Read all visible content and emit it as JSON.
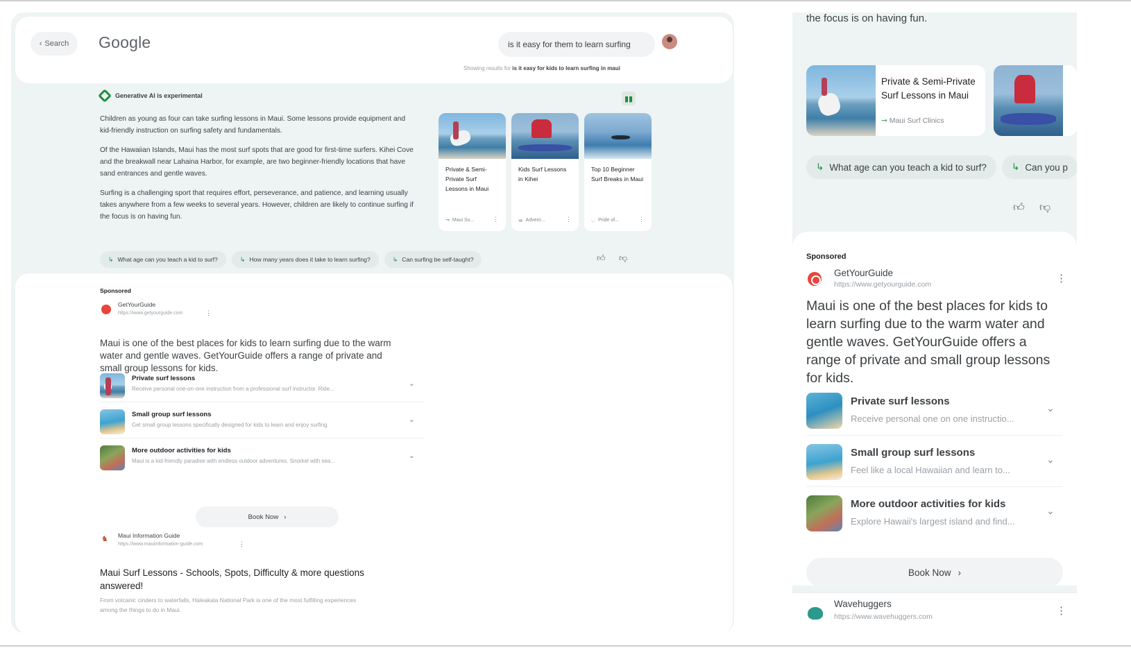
{
  "desktop": {
    "back_label": "Search",
    "logo": "Google",
    "query": "is it easy for them to learn surfing",
    "showing_prefix": "Showing results for",
    "showing_query": "is it easy for kids to learn surfing in maui",
    "ai_label": "Generative AI is experimental",
    "ai_paragraphs": [
      "Children as young as four can take surfing lessons in Maui. Some lessons provide equipment and kid-friendly instruction on surfing safety and fundamentals.",
      "Of the Hawaiian Islands, Maui has the most surf spots that are good for first-time surfers. Kihei Cove and the breakwall near Lahaina Harbor, for example, are two beginner-friendly locations that have sand entrances and gentle waves.",
      "Surfing is a challenging sport that requires effort, perseverance, and patience, and learning usually takes anywhere from a few weeks to several years. However, children are likely to continue surfing if the focus is on having fun."
    ],
    "cards": [
      {
        "title": "Private & Semi-Private Surf Lessons in Maui",
        "source": "Maui Su..."
      },
      {
        "title": "Kids Surf Lessons in Kihei",
        "source": "Advent..."
      },
      {
        "title": "Top 10 Beginner Surf Breaks in Maui",
        "source": "Pride of..."
      }
    ],
    "chips": [
      "What age can you teach a kid to surf?",
      "How many years does it take to learn surfing?",
      "Can surfing be self-taught?"
    ],
    "sponsored": "Sponsored",
    "ad": {
      "site": "GetYourGuide",
      "url": "https://www.getyourguide.com",
      "description": "Maui is one of the best places for kids to learn surfing due to the warm water and gentle waves. GetYourGuide offers a range of private and small group lessons for kids.",
      "offers": [
        {
          "title": "Private surf lessons",
          "desc": "Receive personal one-on-one instruction from a professional surf instructor. Ride..."
        },
        {
          "title": "Small group surf lessons",
          "desc": "Get small group lessons specifically designed for kids to learn and enjoy surfing."
        },
        {
          "title": "More outdoor activities for kids",
          "desc": "Maui is a kid-friendly paradise with endless outdoor adventures. Snorkel with sea..."
        }
      ],
      "book_label": "Book Now"
    },
    "result": {
      "site": "Maui Information Guide",
      "url": "https://www.mauiinformation-guide.com",
      "title": "Maui Surf Lessons - Schools, Spots, Difficulty & more questions answered!",
      "snippet": "From volcanic cinders to waterfalls, Haleakala National Park is one of the most fulfilling experiences among the things to do in Maui."
    }
  },
  "mobile": {
    "fragment": "the focus is on having fun.",
    "card": {
      "title": "Private & Semi-Private Surf Lessons in Maui",
      "source": "Maui Surf Clinics"
    },
    "chip1": "What age can you teach a kid to surf?",
    "chip2": "Can you p",
    "sponsored": "Sponsored",
    "ad": {
      "site": "GetYourGuide",
      "url": "https://www.getyourguide.com",
      "description": "Maui is one of the best places for kids to learn surfing due to the warm water and gentle waves. GetYourGuide offers a range of private and small group lessons for kids.",
      "offers": [
        {
          "title": "Private surf lessons",
          "desc": "Receive personal one on one instructio..."
        },
        {
          "title": "Small group surf lessons",
          "desc": "Feel like a local Hawaiian and learn to..."
        },
        {
          "title": "More outdoor activities for kids",
          "desc": "Explore Hawaii's largest island and find..."
        }
      ],
      "book_label": "Book Now"
    },
    "next_result": {
      "site": "Wavehuggers",
      "url": "https://www.wavehuggers.com"
    }
  },
  "icons": {
    "back": "chevron-left-icon",
    "ai": "sparkle-diamond-icon",
    "layout": "layout-icon",
    "thumbs_up": "thumbs-up-icon",
    "thumbs_down": "thumbs-down-icon",
    "follow_up": "follow-up-arrow-icon",
    "expand": "chevron-down-icon",
    "more": "more-vertical-icon"
  },
  "colors": {
    "accent_green": "#1e8e3e",
    "panel_bg": "#eef3f4",
    "ad_favicon": "#e8453c"
  }
}
